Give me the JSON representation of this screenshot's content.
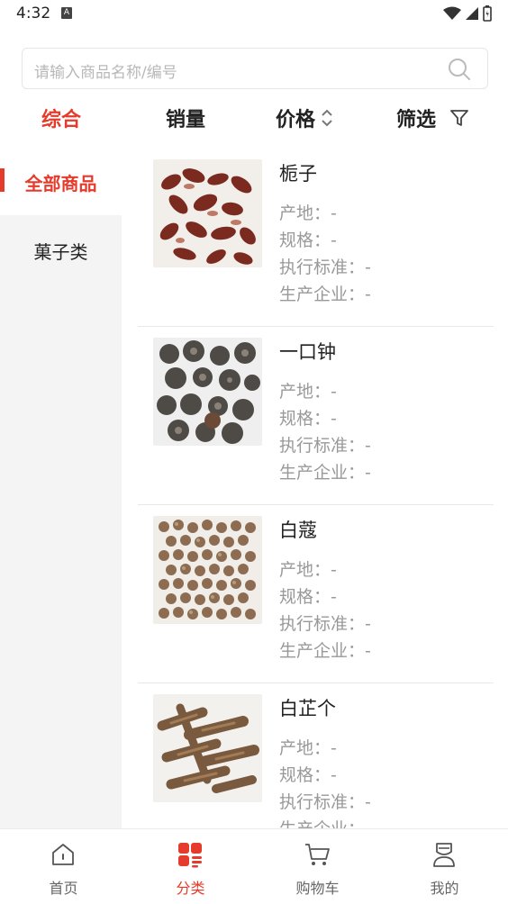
{
  "status_bar": {
    "time": "4:32",
    "a_badge": "A"
  },
  "search": {
    "placeholder": "请输入商品名称/编号"
  },
  "sort_tabs": [
    {
      "label": "综合",
      "active": true
    },
    {
      "label": "销量",
      "active": false
    },
    {
      "label": "价格",
      "active": false
    },
    {
      "label": "筛选",
      "active": false
    }
  ],
  "sidebar": {
    "items": [
      {
        "label": "全部商品",
        "active": true
      },
      {
        "label": "菓子类",
        "active": false
      }
    ]
  },
  "products": [
    {
      "name": "栀子",
      "origin": "产地：-",
      "spec": "规格：-",
      "standard": "执行标准：-",
      "company": "生产企业：-"
    },
    {
      "name": "一口钟",
      "origin": "产地：-",
      "spec": "规格：-",
      "standard": "执行标准：-",
      "company": "生产企业：-"
    },
    {
      "name": "白蔻",
      "origin": "产地：-",
      "spec": "规格：-",
      "standard": "执行标准：-",
      "company": "生产企业：-"
    },
    {
      "name": "白芷个",
      "origin": "产地：-",
      "spec": "规格：-",
      "standard": "执行标准：-",
      "company": "生产企业：-"
    }
  ],
  "tab_bar": [
    {
      "label": "首页",
      "icon": "home-icon",
      "active": false
    },
    {
      "label": "分类",
      "icon": "category-icon",
      "active": true
    },
    {
      "label": "购物车",
      "icon": "cart-icon",
      "active": false
    },
    {
      "label": "我的",
      "icon": "profile-icon",
      "active": false
    }
  ],
  "colors": {
    "accent": "#e53b2c",
    "sidebar_bg": "#f4f4f4",
    "meta_text": "#999999"
  }
}
